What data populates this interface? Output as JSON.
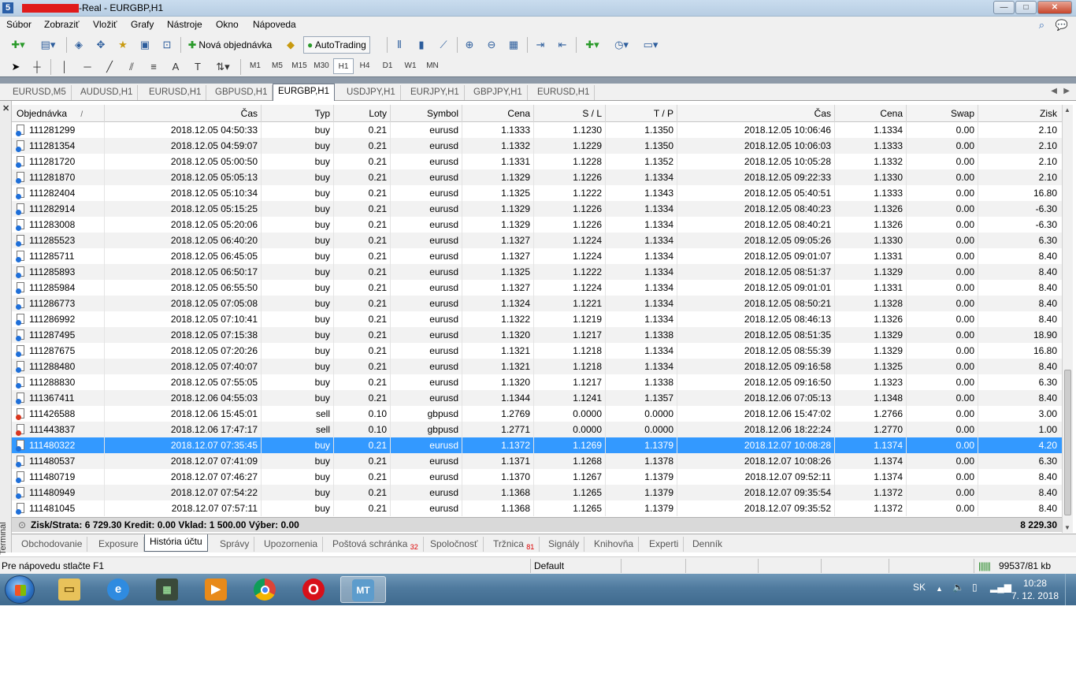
{
  "window": {
    "title": "-Real - EURGBP,H1",
    "min": "—",
    "max": "□",
    "close": "✕"
  },
  "menu": [
    "Súbor",
    "Zobraziť",
    "Vložiť",
    "Grafy",
    "Nástroje",
    "Okno",
    "Nápoveda"
  ],
  "toolbar": {
    "new_order": "Nová objednávka",
    "autotrading": "AutoTrading",
    "timeframes": [
      "M1",
      "M5",
      "M15",
      "M30",
      "H1",
      "H4",
      "D1",
      "W1",
      "MN"
    ],
    "active_timeframe": "H1"
  },
  "chart_tabs": [
    "EURUSD,M5",
    "AUDUSD,H1",
    "EURUSD,H1",
    "GBPUSD,H1",
    "EURGBP,H1",
    "USDJPY,H1",
    "EURJPY,H1",
    "GBPJPY,H1",
    "EURUSD,H1"
  ],
  "active_chart_tab": "EURGBP,H1",
  "terminal": {
    "label": "Terminál",
    "columns": [
      "Objednávka",
      "Čas",
      "Typ",
      "Loty",
      "Symbol",
      "Cena",
      "S / L",
      "T / P",
      "Čas",
      "Cena",
      "Swap",
      "Zisk"
    ],
    "sort_indicator": "/",
    "rows": [
      [
        "111281299",
        "2018.12.05 04:50:33",
        "buy",
        "0.21",
        "eurusd",
        "1.1333",
        "1.1230",
        "1.1350",
        "2018.12.05 10:06:46",
        "1.1334",
        "0.00",
        "2.10"
      ],
      [
        "111281354",
        "2018.12.05 04:59:07",
        "buy",
        "0.21",
        "eurusd",
        "1.1332",
        "1.1229",
        "1.1350",
        "2018.12.05 10:06:03",
        "1.1333",
        "0.00",
        "2.10"
      ],
      [
        "111281720",
        "2018.12.05 05:00:50",
        "buy",
        "0.21",
        "eurusd",
        "1.1331",
        "1.1228",
        "1.1352",
        "2018.12.05 10:05:28",
        "1.1332",
        "0.00",
        "2.10"
      ],
      [
        "111281870",
        "2018.12.05 05:05:13",
        "buy",
        "0.21",
        "eurusd",
        "1.1329",
        "1.1226",
        "1.1334",
        "2018.12.05 09:22:33",
        "1.1330",
        "0.00",
        "2.10"
      ],
      [
        "111282404",
        "2018.12.05 05:10:34",
        "buy",
        "0.21",
        "eurusd",
        "1.1325",
        "1.1222",
        "1.1343",
        "2018.12.05 05:40:51",
        "1.1333",
        "0.00",
        "16.80"
      ],
      [
        "111282914",
        "2018.12.05 05:15:25",
        "buy",
        "0.21",
        "eurusd",
        "1.1329",
        "1.1226",
        "1.1334",
        "2018.12.05 08:40:23",
        "1.1326",
        "0.00",
        "-6.30"
      ],
      [
        "111283008",
        "2018.12.05 05:20:06",
        "buy",
        "0.21",
        "eurusd",
        "1.1329",
        "1.1226",
        "1.1334",
        "2018.12.05 08:40:21",
        "1.1326",
        "0.00",
        "-6.30"
      ],
      [
        "111285523",
        "2018.12.05 06:40:20",
        "buy",
        "0.21",
        "eurusd",
        "1.1327",
        "1.1224",
        "1.1334",
        "2018.12.05 09:05:26",
        "1.1330",
        "0.00",
        "6.30"
      ],
      [
        "111285711",
        "2018.12.05 06:45:05",
        "buy",
        "0.21",
        "eurusd",
        "1.1327",
        "1.1224",
        "1.1334",
        "2018.12.05 09:01:07",
        "1.1331",
        "0.00",
        "8.40"
      ],
      [
        "111285893",
        "2018.12.05 06:50:17",
        "buy",
        "0.21",
        "eurusd",
        "1.1325",
        "1.1222",
        "1.1334",
        "2018.12.05 08:51:37",
        "1.1329",
        "0.00",
        "8.40"
      ],
      [
        "111285984",
        "2018.12.05 06:55:50",
        "buy",
        "0.21",
        "eurusd",
        "1.1327",
        "1.1224",
        "1.1334",
        "2018.12.05 09:01:01",
        "1.1331",
        "0.00",
        "8.40"
      ],
      [
        "111286773",
        "2018.12.05 07:05:08",
        "buy",
        "0.21",
        "eurusd",
        "1.1324",
        "1.1221",
        "1.1334",
        "2018.12.05 08:50:21",
        "1.1328",
        "0.00",
        "8.40"
      ],
      [
        "111286992",
        "2018.12.05 07:10:41",
        "buy",
        "0.21",
        "eurusd",
        "1.1322",
        "1.1219",
        "1.1334",
        "2018.12.05 08:46:13",
        "1.1326",
        "0.00",
        "8.40"
      ],
      [
        "111287495",
        "2018.12.05 07:15:38",
        "buy",
        "0.21",
        "eurusd",
        "1.1320",
        "1.1217",
        "1.1338",
        "2018.12.05 08:51:35",
        "1.1329",
        "0.00",
        "18.90"
      ],
      [
        "111287675",
        "2018.12.05 07:20:26",
        "buy",
        "0.21",
        "eurusd",
        "1.1321",
        "1.1218",
        "1.1334",
        "2018.12.05 08:55:39",
        "1.1329",
        "0.00",
        "16.80"
      ],
      [
        "111288480",
        "2018.12.05 07:40:07",
        "buy",
        "0.21",
        "eurusd",
        "1.1321",
        "1.1218",
        "1.1334",
        "2018.12.05 09:16:58",
        "1.1325",
        "0.00",
        "8.40"
      ],
      [
        "111288830",
        "2018.12.05 07:55:05",
        "buy",
        "0.21",
        "eurusd",
        "1.1320",
        "1.1217",
        "1.1338",
        "2018.12.05 09:16:50",
        "1.1323",
        "0.00",
        "6.30"
      ],
      [
        "111367411",
        "2018.12.06 04:55:03",
        "buy",
        "0.21",
        "eurusd",
        "1.1344",
        "1.1241",
        "1.1357",
        "2018.12.06 07:05:13",
        "1.1348",
        "0.00",
        "8.40"
      ],
      [
        "111426588",
        "2018.12.06 15:45:01",
        "sell",
        "0.10",
        "gbpusd",
        "1.2769",
        "0.0000",
        "0.0000",
        "2018.12.06 15:47:02",
        "1.2766",
        "0.00",
        "3.00"
      ],
      [
        "111443837",
        "2018.12.06 17:47:17",
        "sell",
        "0.10",
        "gbpusd",
        "1.2771",
        "0.0000",
        "0.0000",
        "2018.12.06 18:22:24",
        "1.2770",
        "0.00",
        "1.00"
      ],
      [
        "111480322",
        "2018.12.07 07:35:45",
        "buy",
        "0.21",
        "eurusd",
        "1.1372",
        "1.1269",
        "1.1379",
        "2018.12.07 10:08:28",
        "1.1374",
        "0.00",
        "4.20"
      ],
      [
        "111480537",
        "2018.12.07 07:41:09",
        "buy",
        "0.21",
        "eurusd",
        "1.1371",
        "1.1268",
        "1.1378",
        "2018.12.07 10:08:26",
        "1.1374",
        "0.00",
        "6.30"
      ],
      [
        "111480719",
        "2018.12.07 07:46:27",
        "buy",
        "0.21",
        "eurusd",
        "1.1370",
        "1.1267",
        "1.1379",
        "2018.12.07 09:52:11",
        "1.1374",
        "0.00",
        "8.40"
      ],
      [
        "111480949",
        "2018.12.07 07:54:22",
        "buy",
        "0.21",
        "eurusd",
        "1.1368",
        "1.1265",
        "1.1379",
        "2018.12.07 09:35:54",
        "1.1372",
        "0.00",
        "8.40"
      ],
      [
        "111481045",
        "2018.12.07 07:57:11",
        "buy",
        "0.21",
        "eurusd",
        "1.1368",
        "1.1265",
        "1.1379",
        "2018.12.07 09:35:52",
        "1.1372",
        "0.00",
        "8.40"
      ]
    ],
    "selected_row": 20,
    "summary": "Zisk/Strata: 6 729.30  Kredit: 0.00  Vklad: 1 500.00  Výber: 0.00",
    "total": "8 229.30"
  },
  "bottom_tabs": [
    {
      "label": "Obchodovanie",
      "badge": ""
    },
    {
      "label": "Exposure",
      "badge": ""
    },
    {
      "label": "História účtu",
      "badge": ""
    },
    {
      "label": "Správy",
      "badge": ""
    },
    {
      "label": "Upozornenia",
      "badge": ""
    },
    {
      "label": "Poštová schránka",
      "badge": "32"
    },
    {
      "label": "Spoločnosť",
      "badge": ""
    },
    {
      "label": "Tržnica",
      "badge": "81"
    },
    {
      "label": "Signály",
      "badge": ""
    },
    {
      "label": "Knihovňa",
      "badge": ""
    },
    {
      "label": "Experti",
      "badge": ""
    },
    {
      "label": "Denník",
      "badge": ""
    }
  ],
  "active_bottom_tab": "História účtu",
  "status": {
    "help": "Pre nápovedu stlačte F1",
    "profile": "Default",
    "traffic": "99537/81 kb"
  },
  "taskbar": {
    "language": "SK",
    "time": "10:28",
    "date": "7. 12. 2018",
    "apps": [
      "file-explorer-icon",
      "internet-explorer-icon",
      "terminal-app-icon",
      "media-player-icon",
      "chrome-icon",
      "opera-icon",
      "metatrader-icon"
    ]
  },
  "colors": {
    "selection": "#3399ff",
    "buy_dot": "#1e6fd9",
    "sell_dot": "#d9361e"
  }
}
